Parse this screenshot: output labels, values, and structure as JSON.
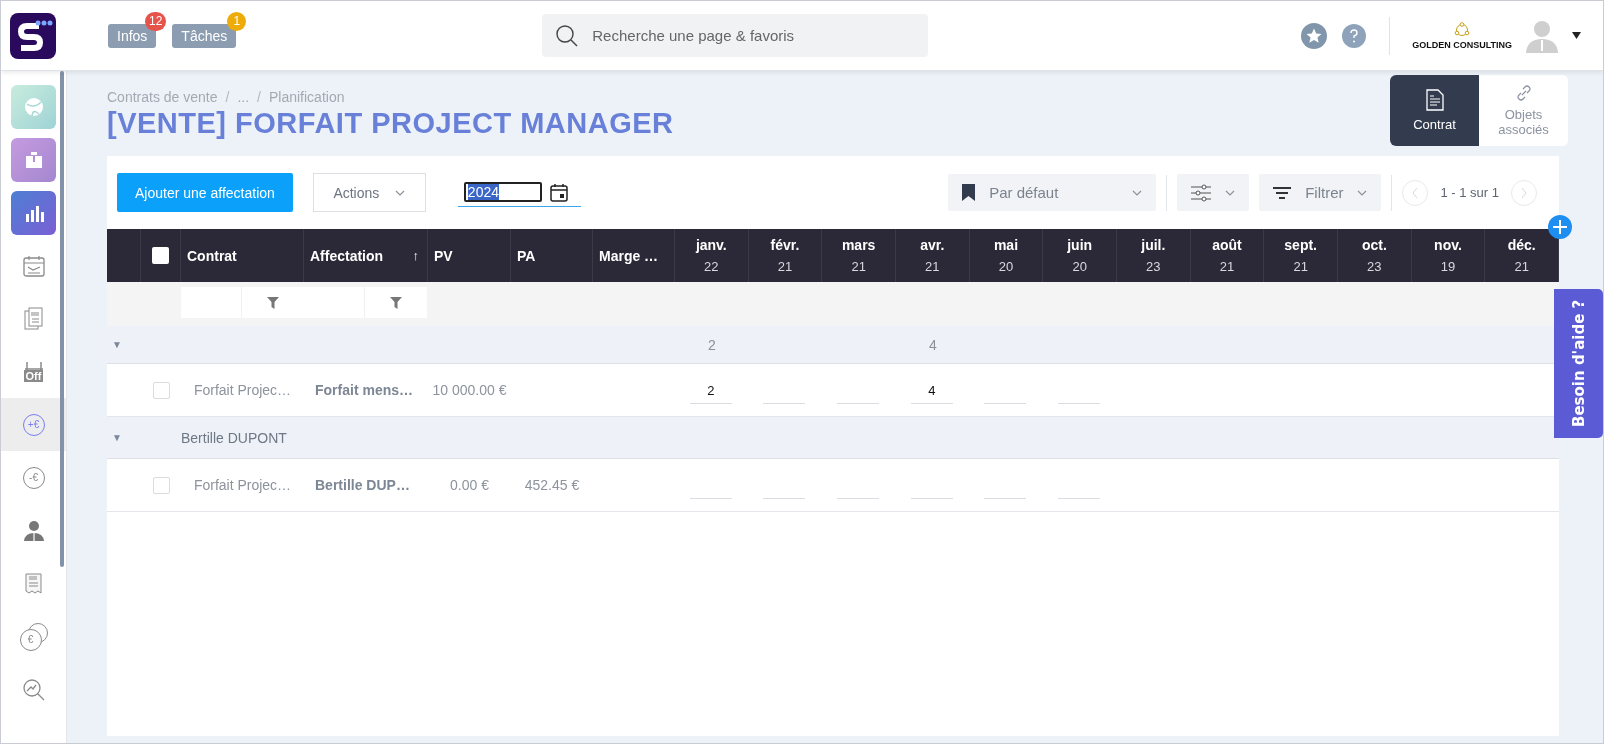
{
  "header": {
    "notifications": [
      {
        "label": "Infos",
        "count": "12",
        "color": "#e5534b"
      },
      {
        "label": "Tâches",
        "count": "1",
        "color": "#eeac0b"
      }
    ],
    "search": {
      "placeholder": "Recherche une page & favoris"
    },
    "company": "GOLDEN CONSULTING"
  },
  "sidebar": {
    "items": [
      {
        "kind": "globe",
        "selected": false
      },
      {
        "kind": "briefcase",
        "selected": false
      },
      {
        "kind": "chart",
        "selected": false
      },
      {
        "kind": "calendar",
        "selected": false
      },
      {
        "kind": "documents",
        "selected": false
      },
      {
        "kind": "off",
        "glyph": "Off",
        "selected": false
      },
      {
        "kind": "coin",
        "glyph": "+€",
        "selected": true
      },
      {
        "kind": "coin",
        "glyph": "-€",
        "selected": false
      },
      {
        "kind": "person",
        "selected": false
      },
      {
        "kind": "receipt",
        "selected": false
      },
      {
        "kind": "coins",
        "glyph": "€",
        "selected": false
      },
      {
        "kind": "trend",
        "selected": false
      }
    ]
  },
  "breadcrumb": [
    {
      "kind": "link",
      "text": "Contrats de vente"
    },
    {
      "kind": "separator",
      "text": "/"
    },
    {
      "kind": "link",
      "text": "..."
    },
    {
      "kind": "separator",
      "text": "/"
    },
    {
      "kind": "link",
      "text": "Planification"
    }
  ],
  "title": "[VENTE] FORFAIT PROJECT MANAGER",
  "view_tabs": [
    {
      "kind": "document",
      "label": "Contrat",
      "selected": true
    },
    {
      "kind": "link",
      "label": "Objets associés",
      "selected": false
    }
  ],
  "toolbar": {
    "add_button": "Ajouter une affectation",
    "actions": "Actions",
    "year": "2024",
    "view": "Par défaut",
    "filter": "Filtrer",
    "pagination": "1 - 1 sur 1"
  },
  "table": {
    "header_checked": false,
    "columns": [
      {
        "label": "Contrat",
        "filter": true
      },
      {
        "label": "Affectation",
        "filter": true,
        "sort": "↑"
      },
      {
        "label": "PV",
        "filter": false
      },
      {
        "label": "PA",
        "filter": false
      },
      {
        "label": "Marge …",
        "filter": false
      }
    ],
    "months": [
      {
        "label": "janv.",
        "days": "22"
      },
      {
        "label": "févr.",
        "days": "21"
      },
      {
        "label": "mars",
        "days": "21"
      },
      {
        "label": "avr.",
        "days": "21"
      },
      {
        "label": "mai",
        "days": "20"
      },
      {
        "label": "juin",
        "days": "20"
      },
      {
        "label": "juil.",
        "days": "23"
      },
      {
        "label": "août",
        "days": "21"
      },
      {
        "label": "sept.",
        "days": "21"
      },
      {
        "label": "oct.",
        "days": "23"
      },
      {
        "label": "nov.",
        "days": "19"
      },
      {
        "label": "déc.",
        "days": "21"
      }
    ],
    "groups": [
      {
        "toggle": "▼",
        "expanded": true,
        "totals": [
          {
            "kind": "value",
            "text": "2"
          },
          {
            "kind": "blank"
          },
          {
            "kind": "blank"
          },
          {
            "kind": "value",
            "text": "4"
          }
        ],
        "rows": [
          {
            "checked": false,
            "contrat": "Forfait Projec…",
            "affectation": "Forfait mens…",
            "pv": "10 000.00 €",
            "cells": [
              "2",
              null,
              null,
              "4",
              null,
              null
            ]
          }
        ]
      },
      {
        "toggle": "▼",
        "name": "Bertille DUPONT",
        "expanded": true,
        "rows": [
          {
            "checked": false,
            "contrat": "Forfait Projec…",
            "affectation": "Bertille DUP…",
            "pv": "0.00 €",
            "pa": "452.45 €",
            "cells": [
              null,
              null,
              null,
              null,
              null,
              null
            ]
          }
        ]
      }
    ]
  },
  "help_tab": "Besoin d'aide ?"
}
